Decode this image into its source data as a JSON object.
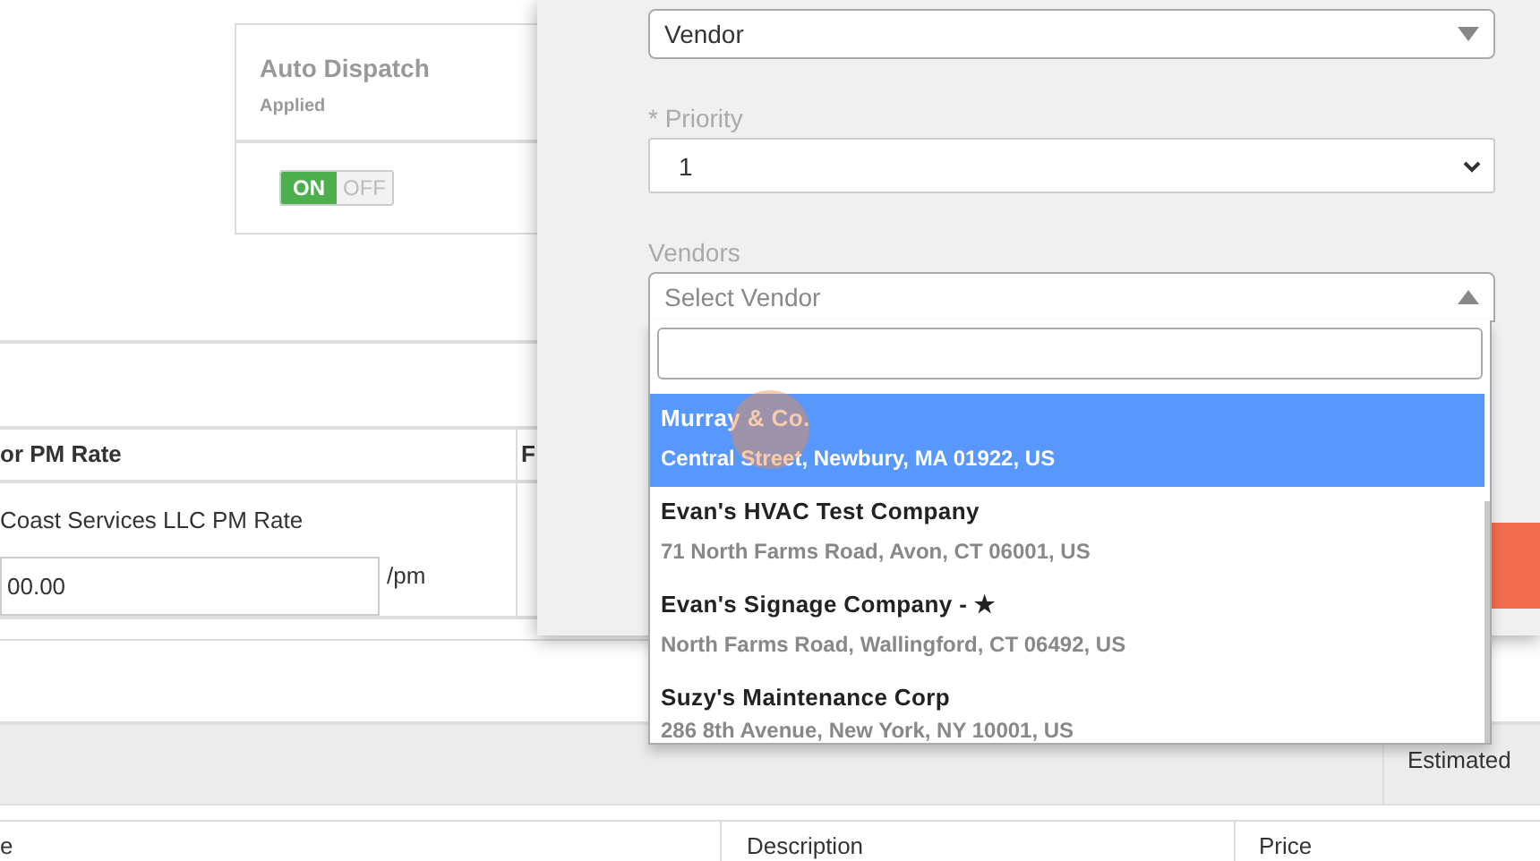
{
  "auto_dispatch": {
    "title": "Auto Dispatch",
    "subtitle": "Applied",
    "toggle": {
      "on": true,
      "on_label": "ON",
      "off_label": "OFF"
    }
  },
  "rate_table": {
    "columns": [
      "or PM Rate",
      "F"
    ],
    "rows": [
      {
        "label": "Coast Services LLC PM Rate",
        "value": "00.00",
        "unit": "/pm"
      }
    ]
  },
  "summary_bar": {
    "column_1": "Estimated"
  },
  "items_table": {
    "columns": [
      "e",
      "Description",
      "Price"
    ]
  },
  "modal": {
    "type_select": {
      "value": "Vendor"
    },
    "priority": {
      "label": "* Priority",
      "value": "1"
    },
    "vendors": {
      "label": "Vendors",
      "placeholder": "Select Vendor",
      "expanded": true,
      "options": [
        {
          "name": "Murray & Co.",
          "address": "Central Street, Newbury, MA 01922, US",
          "selected": true
        },
        {
          "name": "Evan's HVAC Test Company",
          "address": "71 North Farms Road, Avon, CT 06001, US",
          "selected": false
        },
        {
          "name": "Evan's Signage Company - ★",
          "address": "North Farms Road, Wallingford, CT 06492, US",
          "selected": false
        },
        {
          "name": "Suzy's Maintenance Corp",
          "address": "286 8th Avenue, New York, NY 10001, US",
          "selected": false
        }
      ]
    }
  }
}
